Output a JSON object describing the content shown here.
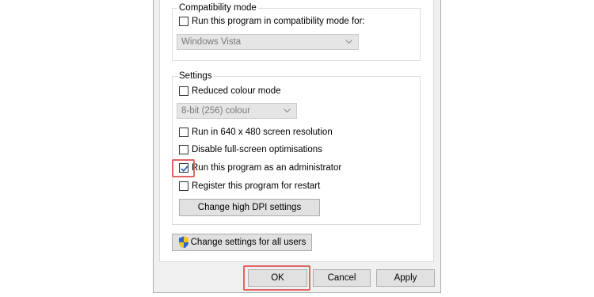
{
  "compatibility": {
    "title": "Compatibility mode",
    "run_compat_label": "Run this program in compatibility mode for:",
    "run_compat_checked": false,
    "os_select_value": "Windows Vista"
  },
  "settings": {
    "title": "Settings",
    "reduced_colour_label": "Reduced colour mode",
    "reduced_colour_checked": false,
    "colour_select_value": "8-bit (256) colour",
    "resolution_label": "Run in 640 x 480 screen resolution",
    "resolution_checked": false,
    "fullscreen_label": "Disable full-screen optimisations",
    "fullscreen_checked": false,
    "admin_label": "Run this program as an administrator",
    "admin_checked": true,
    "restart_label": "Register this program for restart",
    "restart_checked": false,
    "dpi_button_label": "Change high DPI settings"
  },
  "all_users_button_label": "Change settings for all users",
  "footer": {
    "ok_label": "OK",
    "cancel_label": "Cancel",
    "apply_label": "Apply"
  },
  "colors": {
    "highlight": "#e06666",
    "checkmark": "#1b5fb8"
  },
  "icons": [
    "chevron-down-icon",
    "checkmark-icon",
    "uac-shield-icon"
  ]
}
